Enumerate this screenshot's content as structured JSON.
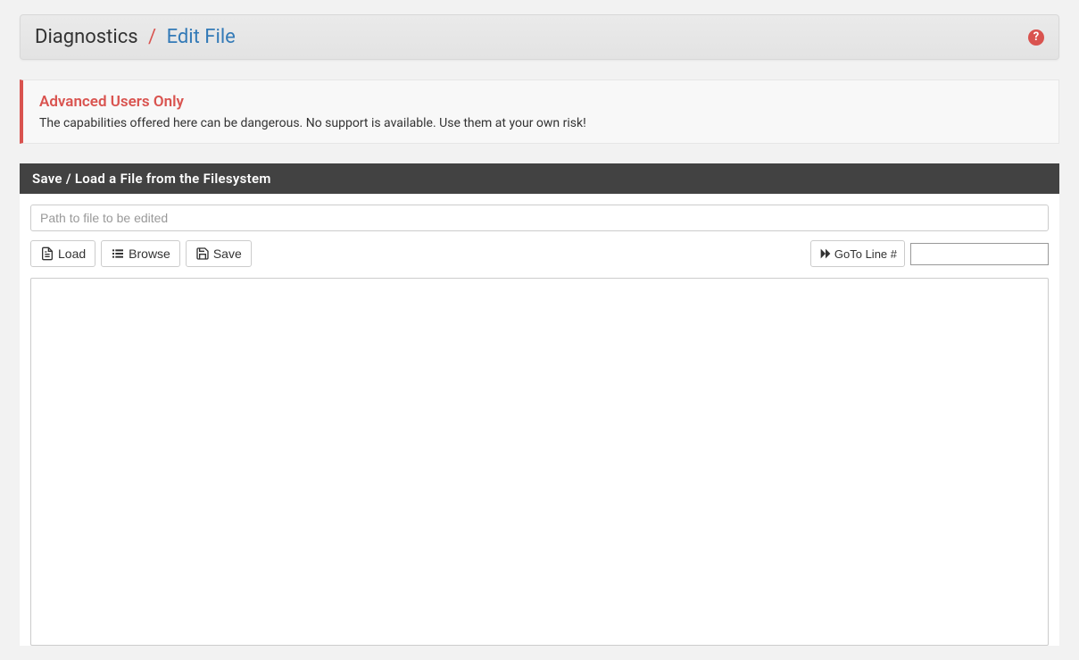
{
  "breadcrumb": {
    "parent": "Diagnostics",
    "separator": "/",
    "current": "Edit File"
  },
  "help_icon_label": "?",
  "alert": {
    "title": "Advanced Users Only",
    "body": "The capabilities offered here can be dangerous. No support is available. Use them at your own risk!"
  },
  "panel": {
    "header": "Save / Load a File from the Filesystem",
    "path_placeholder": "Path to file to be edited",
    "path_value": ""
  },
  "toolbar": {
    "load_label": "Load",
    "browse_label": "Browse",
    "save_label": "Save",
    "goto_label": "GoTo Line #",
    "goto_value": ""
  },
  "editor": {
    "content": ""
  }
}
